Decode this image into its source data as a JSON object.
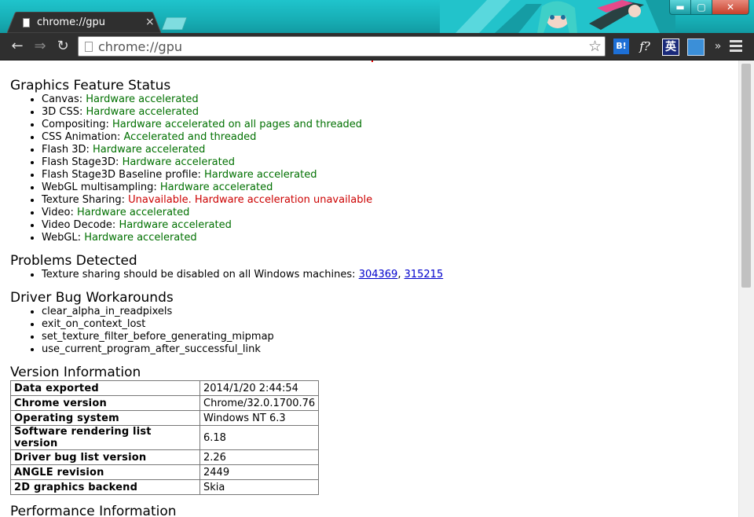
{
  "tab": {
    "title": "chrome://gpu",
    "close": "×"
  },
  "window": {
    "minimize": "▬",
    "maximize": "▢",
    "close": "✕"
  },
  "toolbar": {
    "back": "←",
    "forward": "⇒",
    "reload": "↻",
    "url": "chrome://gpu",
    "star": "☆",
    "extensions": [
      {
        "icon": "hatena-bookmark-icon",
        "label": "B!"
      },
      {
        "icon": "function-icon",
        "label": "f?"
      },
      {
        "icon": "english-dictionary-icon",
        "label": "英"
      },
      {
        "icon": "screenshot-icon",
        "label": ""
      }
    ],
    "overflow": "»"
  },
  "feature_status": {
    "heading": "Graphics Feature Status",
    "items": [
      {
        "name": "Canvas",
        "value": "Hardware accelerated",
        "state": "ok"
      },
      {
        "name": "3D CSS",
        "value": "Hardware accelerated",
        "state": "ok"
      },
      {
        "name": "Compositing",
        "value": "Hardware accelerated on all pages and threaded",
        "state": "ok"
      },
      {
        "name": "CSS Animation",
        "value": "Accelerated and threaded",
        "state": "ok"
      },
      {
        "name": "Flash 3D",
        "value": "Hardware accelerated",
        "state": "ok"
      },
      {
        "name": "Flash Stage3D",
        "value": "Hardware accelerated",
        "state": "ok"
      },
      {
        "name": "Flash Stage3D Baseline profile",
        "value": "Hardware accelerated",
        "state": "ok"
      },
      {
        "name": "WebGL multisampling",
        "value": "Hardware accelerated",
        "state": "ok"
      },
      {
        "name": "Texture Sharing",
        "value": "Unavailable. Hardware acceleration unavailable",
        "state": "bad"
      },
      {
        "name": "Video",
        "value": "Hardware accelerated",
        "state": "ok"
      },
      {
        "name": "Video Decode",
        "value": "Hardware accelerated",
        "state": "ok"
      },
      {
        "name": "WebGL",
        "value": "Hardware accelerated",
        "state": "ok"
      }
    ]
  },
  "problems": {
    "heading": "Problems Detected",
    "text": "Texture sharing should be disabled on all Windows machines: ",
    "link1": "304369",
    "sep": ", ",
    "link2": "315215"
  },
  "workarounds": {
    "heading": "Driver Bug Workarounds",
    "items": [
      "clear_alpha_in_readpixels",
      "exit_on_context_lost",
      "set_texture_filter_before_generating_mipmap",
      "use_current_program_after_successful_link"
    ]
  },
  "version": {
    "heading": "Version Information",
    "rows": [
      {
        "key": "Data exported",
        "value": "2014/1/20 2:44:54"
      },
      {
        "key": "Chrome version",
        "value": "Chrome/32.0.1700.76"
      },
      {
        "key": "Operating system",
        "value": "Windows NT 6.3"
      },
      {
        "key": "Software rendering list version",
        "value": "6.18"
      },
      {
        "key": "Driver bug list version",
        "value": "2.26"
      },
      {
        "key": "ANGLE revision",
        "value": "2449"
      },
      {
        "key": "2D graphics backend",
        "value": "Skia"
      }
    ]
  },
  "performance": {
    "heading": "Performance Information"
  },
  "colors": {
    "ok": "#007000",
    "bad": "#cc0000",
    "frame": "#17aeb5",
    "link": "#0000cc"
  }
}
